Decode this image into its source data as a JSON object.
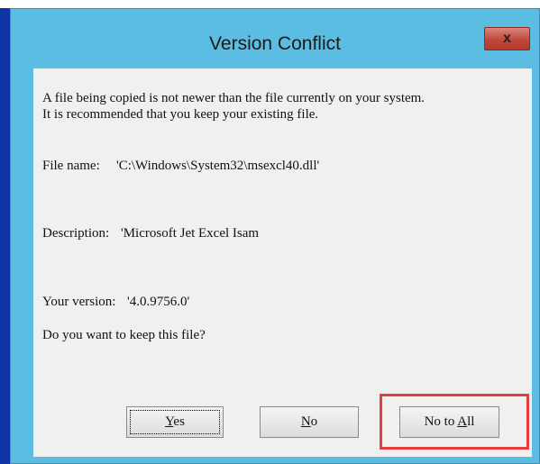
{
  "window": {
    "title": "Version Conflict",
    "close_label": "x"
  },
  "message": {
    "line1": "A file being copied is not newer than the file currently on your system.",
    "line2": "It is recommended that you keep your existing file.",
    "file_name_label": "File name:",
    "file_name_value": "'C:\\Windows\\System32\\msexcl40.dll'",
    "description_label": "Description:",
    "description_value": "'Microsoft Jet Excel Isam",
    "version_label": "Your version:",
    "version_value": "'4.0.9756.0'",
    "question": "Do you want to keep this file?"
  },
  "buttons": {
    "yes_mnemonic": "Y",
    "yes_rest": "es",
    "no_mnemonic": "N",
    "no_rest": "o",
    "noall_prefix": "No to ",
    "noall_mnemonic": "A",
    "noall_rest": "ll"
  },
  "colors": {
    "title_bar": "#5bbde2",
    "close_button": "#c0483a",
    "client_background": "#f0f0f0",
    "highlight": "#e83e3e"
  }
}
